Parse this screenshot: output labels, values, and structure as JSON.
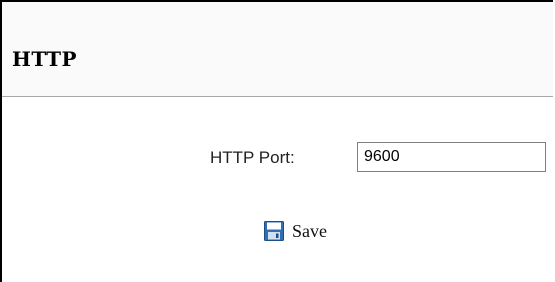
{
  "section": {
    "title": "HTTP"
  },
  "form": {
    "port_label": "HTTP Port:",
    "port_value": "9600"
  },
  "actions": {
    "save_label": "Save",
    "save_icon": "floppy-disk-icon"
  },
  "colors": {
    "header_border": "#a8a8a8",
    "input_border": "#808080",
    "icon_blue": "#2f6fb2"
  }
}
